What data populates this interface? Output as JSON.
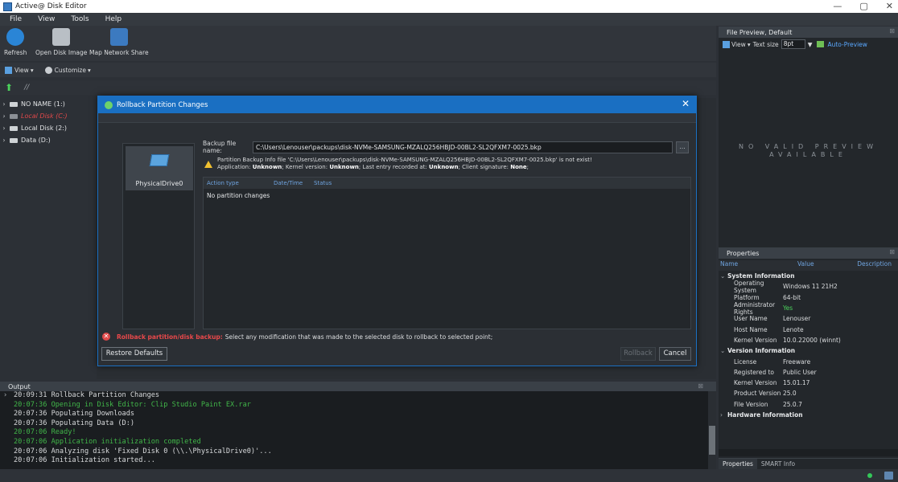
{
  "window": {
    "title": "Active@ Disk Editor",
    "minimize": "—",
    "maximize": "▢",
    "close": "✕"
  },
  "menu": [
    "File",
    "View",
    "Tools",
    "Help"
  ],
  "toolbar": {
    "refresh": "Refresh",
    "open_disk_image": "Open Disk Image",
    "map_network_share": "Map Network Share",
    "view": "View",
    "customize": "Customize"
  },
  "path": {
    "text": "//"
  },
  "tree": [
    {
      "label": "NO NAME (1:)",
      "style": "normal"
    },
    {
      "label": "Local Disk (C:)",
      "style": "red"
    },
    {
      "label": "Local Disk (2:)",
      "style": "normal"
    },
    {
      "label": "Data (D:)",
      "style": "normal"
    }
  ],
  "file_preview": {
    "title": "File Preview, Default",
    "view": "View",
    "text_size_label": "Text size",
    "text_size_value": "8pt",
    "auto_preview": "Auto-Preview",
    "no_preview_line1": "NO VALID PREVIEW",
    "no_preview_line2": "AVAILABLE"
  },
  "properties": {
    "title": "Properties",
    "columns": [
      "Name",
      "Value",
      "Description"
    ],
    "system_information": "System Information",
    "system_rows": [
      {
        "k": "Operating System",
        "v": "Windows 11 21H2"
      },
      {
        "k": "Platform",
        "v": "64-bit"
      },
      {
        "k": "Administrator Rights",
        "v": "Yes"
      },
      {
        "k": "User Name",
        "v": "Lenouser"
      },
      {
        "k": "Host Name",
        "v": "Lenote"
      },
      {
        "k": "Kernel Version",
        "v": "10.0.22000 (winnt)"
      }
    ],
    "version_information": "Version Information",
    "version_rows": [
      {
        "k": "License",
        "v": "Freeware"
      },
      {
        "k": "Registered to",
        "v": "Public User"
      },
      {
        "k": "Kernel Version",
        "v": "15.01.17"
      },
      {
        "k": "Product Version",
        "v": "25.0"
      },
      {
        "k": "File Version",
        "v": "25.0.7"
      }
    ],
    "hardware_information": "Hardware Information",
    "tabs": [
      "Properties",
      "SMART Info"
    ]
  },
  "output": {
    "title": "Output",
    "lines": [
      {
        "text": "20:09:31 Rollback Partition Changes",
        "color": "white"
      },
      {
        "text": "20:07:36 Opening in Disk Editor: Clip Studio Paint EX.rar",
        "color": "green"
      },
      {
        "text": "20:07:36 Populating Downloads",
        "color": "white"
      },
      {
        "text": "20:07:36 Populating Data (D:)",
        "color": "white"
      },
      {
        "text": "20:07:06 Ready!",
        "color": "green"
      },
      {
        "text": "20:07:06 Application initialization completed",
        "color": "green"
      },
      {
        "text": "20:07:06 Analyzing disk 'Fixed Disk 0 (\\\\.\\PhysicalDrive0)'...",
        "color": "white"
      },
      {
        "text": "20:07:06 Initialization started...",
        "color": "white"
      }
    ]
  },
  "dialog": {
    "title": "Rollback Partition Changes",
    "drive_label": "PhysicalDrive0",
    "backup_label": "Backup file name:",
    "backup_value": "C:\\Users\\Lenouser\\packups\\disk-NVMe-SAMSUNG-MZALQ256HBJD-00BL2-SL2QFXM7-0025.bkp",
    "browse": "...",
    "warn_line1": "Partition Backup Info file 'C:\\Users\\Lenouser\\packups\\disk-NVMe-SAMSUNG-MZALQ256HBJD-00BL2-SL2QFXM7-0025.bkp' is not exist!",
    "warn_application_label": "Application:",
    "warn_application": "Unknown",
    "warn_kernel_label": "; Kernel version:",
    "warn_kernel": "Unknown",
    "warn_last_label": "; Last entry recorded at:",
    "warn_last": "Unknown",
    "warn_client_label": "; Client signature:",
    "warn_client": "None",
    "warn_end": ";",
    "columns": [
      "Action type",
      "Date/Time",
      "Status"
    ],
    "empty_text": "No partition changes",
    "status_header": "Rollback partition/disk backup:",
    "status_body": "Select any modification that was made to the selected disk to rollback to selected point;",
    "restore_defaults": "Restore Defaults",
    "rollback": "Rollback",
    "cancel": "Cancel"
  },
  "colors": {
    "accent": "#1a6fc2",
    "error": "#e8484a",
    "green_log": "#41b649"
  }
}
